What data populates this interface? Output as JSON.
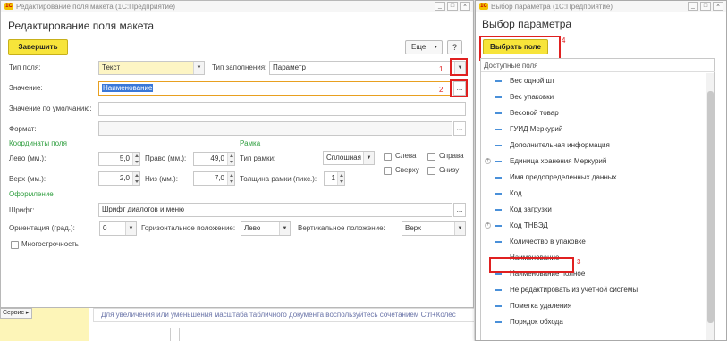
{
  "main_window": {
    "title": "Редактирование поля макета (1С:Предприятие)",
    "heading": "Редактирование поля макета",
    "finish_button": "Завершить",
    "more_button": "Еще",
    "help_button": "?",
    "field_type_label": "Тип поля:",
    "field_type_value": "Текст",
    "fill_type_label": "Тип заполнения:",
    "fill_type_value": "Параметр",
    "value_label": "Значение:",
    "value_value": "Наименование",
    "default_value_label": "Значение по умолчанию:",
    "format_label": "Формат:",
    "coords_section": "Координаты поля",
    "left_label": "Лево (мм.):",
    "left_value": "5,0",
    "right_label": "Право (мм.):",
    "right_value": "49,0",
    "top_label": "Верх (мм.):",
    "top_value": "2,0",
    "bottom_label": "Низ (мм.):",
    "bottom_value": "7,0",
    "frame_section": "Рамка",
    "frame_type_label": "Тип рамки:",
    "frame_type_value": "Сплошная",
    "frame_thickness_label": "Толщина рамки (пикс.):",
    "frame_thickness_value": "1",
    "cb_left": "Слева",
    "cb_right": "Справа",
    "cb_top": "Сверху",
    "cb_bottom": "Снизу",
    "design_section": "Оформление",
    "font_label": "Шрифт:",
    "font_value": "Шрифт диалогов и меню",
    "orientation_label": "Ориентация (град.):",
    "orientation_value": "0",
    "halign_label": "Горизонтальное положение:",
    "halign_value": "Лево",
    "valign_label": "Вертикальное положение:",
    "valign_value": "Верх",
    "multiline_label": "Многострочность",
    "ellipsis": "..."
  },
  "annotations": [
    "1",
    "2",
    "3",
    "4"
  ],
  "background": {
    "service_button": "Сервис ▸",
    "hint_text": "Для увеличения или уменьшения масштаба табличного документа воспользуйтесь сочетанием Ctrl+Колес"
  },
  "param_window": {
    "title": "Выбор параметра (1С:Предприятие)",
    "heading": "Выбор параметра",
    "select_button": "Выбрать поле",
    "list_header": "Доступные поля",
    "items": [
      {
        "label": "Вес одной шт",
        "expandable": false
      },
      {
        "label": "Вес упаковки",
        "expandable": false
      },
      {
        "label": "Весовой товар",
        "expandable": false
      },
      {
        "label": "ГУИД Меркурий",
        "expandable": false
      },
      {
        "label": "Дополнительная информация",
        "expandable": false
      },
      {
        "label": "Единица хранения Меркурий",
        "expandable": true
      },
      {
        "label": "Имя предопределенных данных",
        "expandable": false
      },
      {
        "label": "Код",
        "expandable": false
      },
      {
        "label": "Код загрузки",
        "expandable": false
      },
      {
        "label": "Код ТНВЭД",
        "expandable": true
      },
      {
        "label": "Количество в упаковке",
        "expandable": false
      },
      {
        "label": "Наименование",
        "expandable": false
      },
      {
        "label": "Наименование полное",
        "expandable": false
      },
      {
        "label": "Не редактировать из учетной системы",
        "expandable": false
      },
      {
        "label": "Пометка удаления",
        "expandable": false
      },
      {
        "label": "Порядок обхода",
        "expandable": false
      }
    ]
  },
  "colors": {
    "accent_yellow": "#f7e43a",
    "highlight_red": "#e02020",
    "section_green": "#2e9e3e",
    "selection_blue": "#3a78d8"
  }
}
